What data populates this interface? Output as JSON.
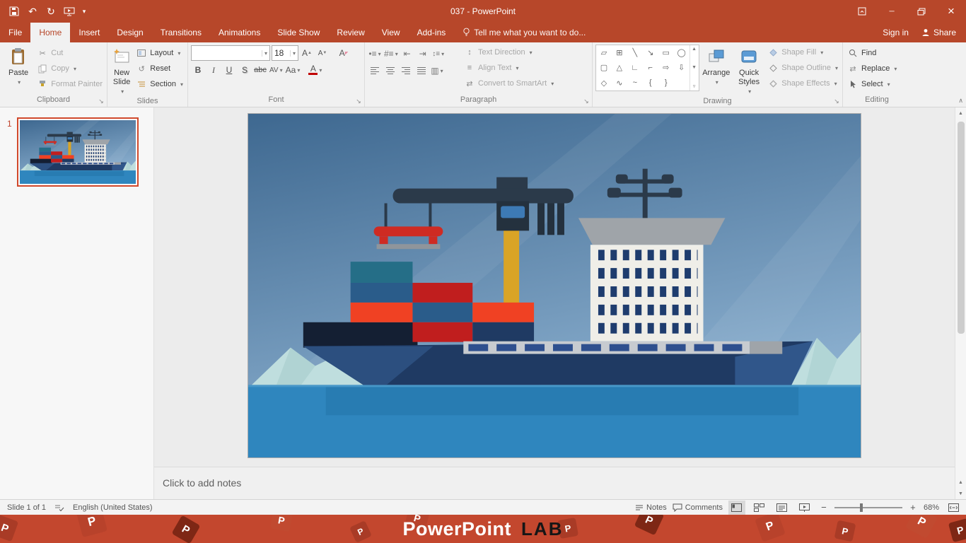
{
  "colors": {
    "chrome": "#B7472A",
    "ribbon_bg": "#F1F1F1",
    "banner_bg": "#C3472E",
    "selection_border": "#D0492C"
  },
  "titlebar": {
    "title": "037 - PowerPoint"
  },
  "tabs": [
    "File",
    "Home",
    "Insert",
    "Design",
    "Transitions",
    "Animations",
    "Slide Show",
    "Review",
    "View",
    "Add-ins"
  ],
  "tellme": {
    "label": "Tell me what you want to do..."
  },
  "account": {
    "sign_in": "Sign in",
    "share": "Share"
  },
  "ribbon": {
    "clipboard": {
      "label": "Clipboard",
      "paste": "Paste",
      "cut": "Cut",
      "copy": "Copy",
      "format_painter": "Format Painter"
    },
    "slides": {
      "label": "Slides",
      "new_slide_1": "New",
      "new_slide_2": "Slide",
      "layout": "Layout",
      "reset": "Reset",
      "section": "Section"
    },
    "font": {
      "label": "Font",
      "font_name": "",
      "font_size": "18",
      "bold": "B",
      "italic": "I",
      "underline": "U",
      "shadow": "S",
      "strike": "abc",
      "spacing": "AV",
      "case_btn": "Aa",
      "color_btn": "A"
    },
    "paragraph": {
      "label": "Paragraph",
      "text_direction": "Text Direction",
      "align_text": "Align Text",
      "convert": "Convert to SmartArt"
    },
    "drawing": {
      "label": "Drawing",
      "arrange": "Arrange",
      "quick_styles_1": "Quick",
      "quick_styles_2": "Styles",
      "shape_fill": "Shape Fill",
      "shape_outline": "Shape Outline",
      "shape_effects": "Shape Effects"
    },
    "editing": {
      "label": "Editing",
      "find": "Find",
      "replace": "Replace",
      "select": "Select"
    }
  },
  "slides_panel": {
    "slide_number": "1"
  },
  "notes": {
    "placeholder": "Click to add notes"
  },
  "statusbar": {
    "slide_counter": "Slide 1 of 1",
    "language": "English (United States)",
    "notes": "Notes",
    "comments": "Comments",
    "zoom": "68%"
  },
  "banner": {
    "brand": "PowerPoint",
    "suffix": "LAB",
    "tile_letter": "P"
  },
  "icons": {
    "undo": "↶",
    "redo": "↻",
    "cut": "✂",
    "bullets": "•≡",
    "numbering": "#≡",
    "indent_decrease": "⇤",
    "indent_increase": "⇥",
    "line_spacing": "↕≡",
    "columns": "▥",
    "replace": "⇄",
    "text_direction_icon": "↕",
    "align_text_icon": "≡",
    "smartart_icon": "⇄",
    "shapes_row1": [
      "▱",
      "⊞",
      "╲",
      "↘",
      "▭",
      "◯"
    ],
    "shapes_row2": [
      "▢",
      "△",
      "∟",
      "⌐",
      "⇨",
      "⇩"
    ],
    "shapes_row3": [
      "◇",
      "∿",
      "~",
      "{",
      "}",
      ""
    ]
  },
  "slide_art": {
    "sky_top": "#3E6890",
    "sky_bottom": "#8FB3D2",
    "water": "#2F86BE",
    "hull": "#1F3A63",
    "hull_dark": "#141F33",
    "hull_light": "#2C4F7F",
    "container_red": "#C01E1E",
    "container_orange": "#F04123",
    "container_blue": "#2A5C8A",
    "container_teal": "#256E87",
    "crane_dark": "#2B3A4A",
    "crane_yellow": "#D9A426",
    "spreader_red": "#CE2B23",
    "building": "#EFEEE8",
    "building_window": "#1E3C6E",
    "superstructure_gray": "#9FA4A9",
    "deck_stripe": "#C7CBD0",
    "deck_window": "#2E4F8E",
    "iceberg": "#BFDEDE"
  }
}
